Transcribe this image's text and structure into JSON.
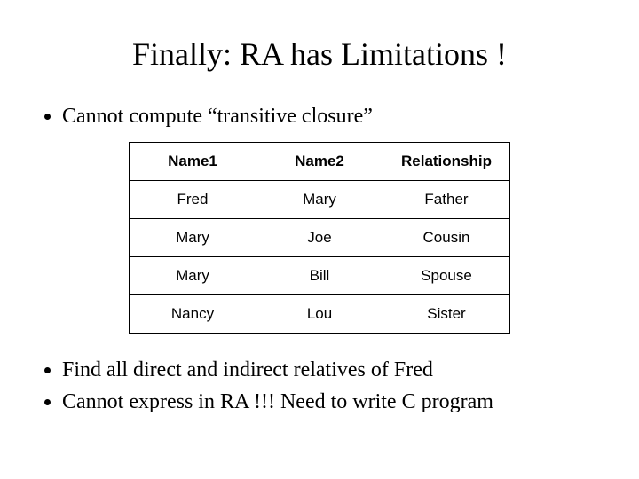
{
  "title": "Finally: RA has Limitations !",
  "bullets_top": [
    "Cannot compute “transitive closure”"
  ],
  "table": {
    "headers": [
      "Name1",
      "Name2",
      "Relationship"
    ],
    "rows": [
      [
        "Fred",
        "Mary",
        "Father"
      ],
      [
        "Mary",
        "Joe",
        "Cousin"
      ],
      [
        "Mary",
        "Bill",
        "Spouse"
      ],
      [
        "Nancy",
        "Lou",
        "Sister"
      ]
    ]
  },
  "bullets_bottom": [
    "Find all direct and indirect relatives of Fred",
    "Cannot express in RA !!!  Need to write C program"
  ]
}
